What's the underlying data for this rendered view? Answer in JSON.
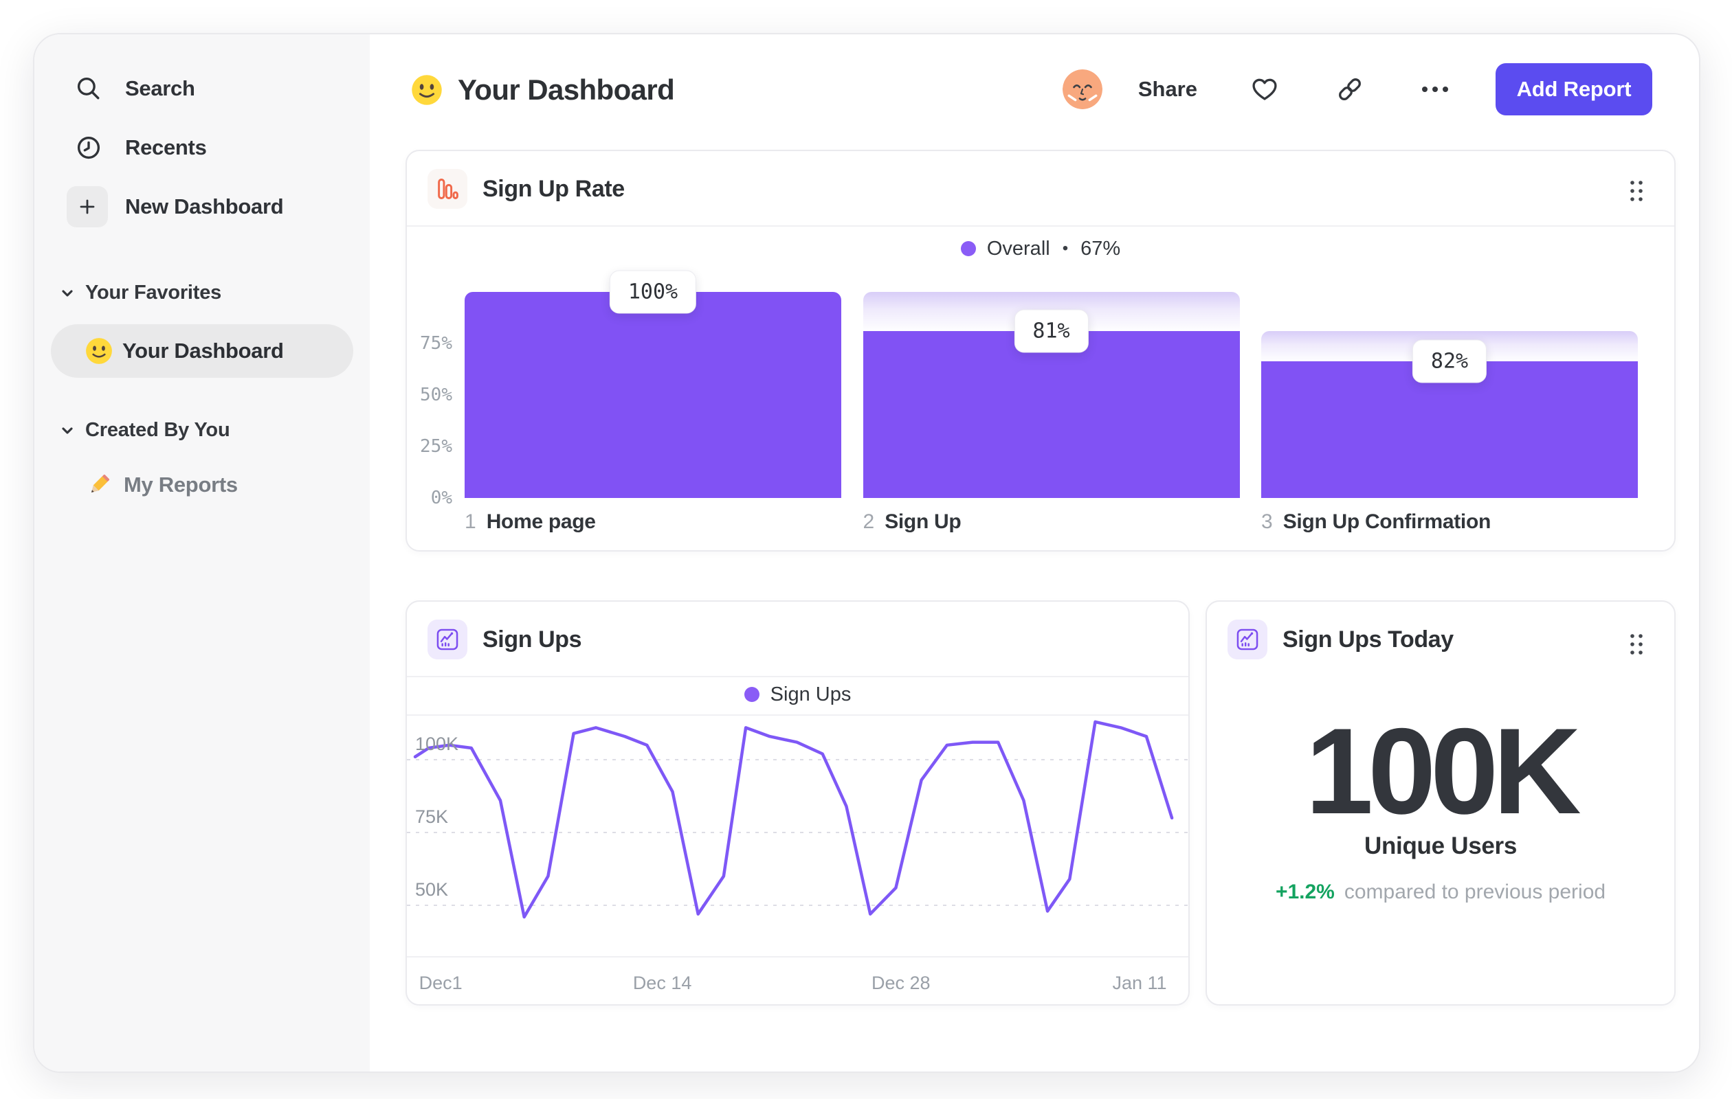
{
  "sidebar": {
    "primary": [
      {
        "label": "Search",
        "icon": "search-icon"
      },
      {
        "label": "Recents",
        "icon": "clock-icon"
      },
      {
        "label": "New Dashboard",
        "icon": "plus-icon"
      }
    ],
    "sections": [
      {
        "title": "Your Favorites",
        "items": [
          {
            "label": "Your Dashboard",
            "icon": "smiley-emoji",
            "selected": true
          }
        ]
      },
      {
        "title": "Created By You",
        "items": [
          {
            "label": "My Reports",
            "icon": "pencil-emoji",
            "selected": false
          }
        ]
      }
    ]
  },
  "header": {
    "title": "Your Dashboard",
    "actions": {
      "share": "Share",
      "add_report": "Add Report"
    }
  },
  "cards": {
    "funnel": {
      "title": "Sign Up Rate"
    },
    "line": {
      "title": "Sign Ups"
    },
    "stat": {
      "title": "Sign Ups Today",
      "value": "100K",
      "label": "Unique Users",
      "delta": "+1.2%",
      "delta_note": "compared to previous period"
    }
  },
  "chart_data": [
    {
      "type": "bar",
      "subtype": "funnel",
      "title": "Sign Up Rate",
      "legend": {
        "series": "Overall",
        "separator": "•",
        "value": "67%"
      },
      "ylim": [
        0,
        100
      ],
      "grid": false,
      "y_axis": [
        {
          "label": "75%",
          "value": 75
        },
        {
          "label": "50%",
          "value": 50
        },
        {
          "label": "25%",
          "value": 25
        },
        {
          "label": "0%",
          "value": 0
        }
      ],
      "steps": [
        {
          "index": "1",
          "label": "Home page",
          "conversion": "100%",
          "overall_pct": 100
        },
        {
          "index": "2",
          "label": "Sign Up",
          "conversion": "81%",
          "overall_pct": 81
        },
        {
          "index": "3",
          "label": "Sign Up Confirmation",
          "conversion": "82%",
          "overall_pct": 66.4
        }
      ]
    },
    {
      "type": "line",
      "title": "Sign Ups",
      "legend": {
        "series": "Sign Ups"
      },
      "value_unit": "K",
      "grid": "dashed-horizontal",
      "legend_position": "top-center",
      "y_axis": [
        {
          "label": "100K",
          "value": 100
        },
        {
          "label": "75K",
          "value": 75
        },
        {
          "label": "50K",
          "value": 50
        }
      ],
      "x_axis": [
        {
          "label": "Dec1",
          "day": 1.5
        },
        {
          "label": "Dec 14",
          "day": 14.5
        },
        {
          "label": "Dec 28",
          "day": 28.5
        },
        {
          "label": "Jan 11",
          "day": 42.5
        }
      ],
      "points_day_valueK": [
        [
          0,
          101
        ],
        [
          0.8,
          104
        ],
        [
          2,
          105
        ],
        [
          3.3,
          104
        ],
        [
          5,
          86
        ],
        [
          6.4,
          46
        ],
        [
          7.8,
          60
        ],
        [
          9.3,
          109
        ],
        [
          10.6,
          111
        ],
        [
          12.3,
          108
        ],
        [
          13.6,
          105
        ],
        [
          15.1,
          89
        ],
        [
          16.6,
          47
        ],
        [
          18.1,
          60
        ],
        [
          19.4,
          111
        ],
        [
          20.8,
          108
        ],
        [
          22.4,
          106
        ],
        [
          23.9,
          102
        ],
        [
          25.3,
          84
        ],
        [
          26.7,
          47
        ],
        [
          28.2,
          56
        ],
        [
          29.7,
          93
        ],
        [
          31.2,
          105
        ],
        [
          32.7,
          106
        ],
        [
          34.2,
          106
        ],
        [
          35.7,
          86
        ],
        [
          37.1,
          48
        ],
        [
          38.4,
          59
        ],
        [
          39.9,
          113
        ],
        [
          41.4,
          111
        ],
        [
          42.9,
          108
        ],
        [
          44.4,
          80
        ]
      ]
    }
  ],
  "colors": {
    "accent": "#5b4cf0",
    "funnel_bar": "#8152f4",
    "funnel_gradient_top": "#d8cdf8",
    "line": "#7e58f6",
    "legend_dot": "#8a5cf6",
    "positive_green": "#14a360",
    "icon_orange": "#f0694a",
    "icon_purple": "#7c4df0"
  }
}
